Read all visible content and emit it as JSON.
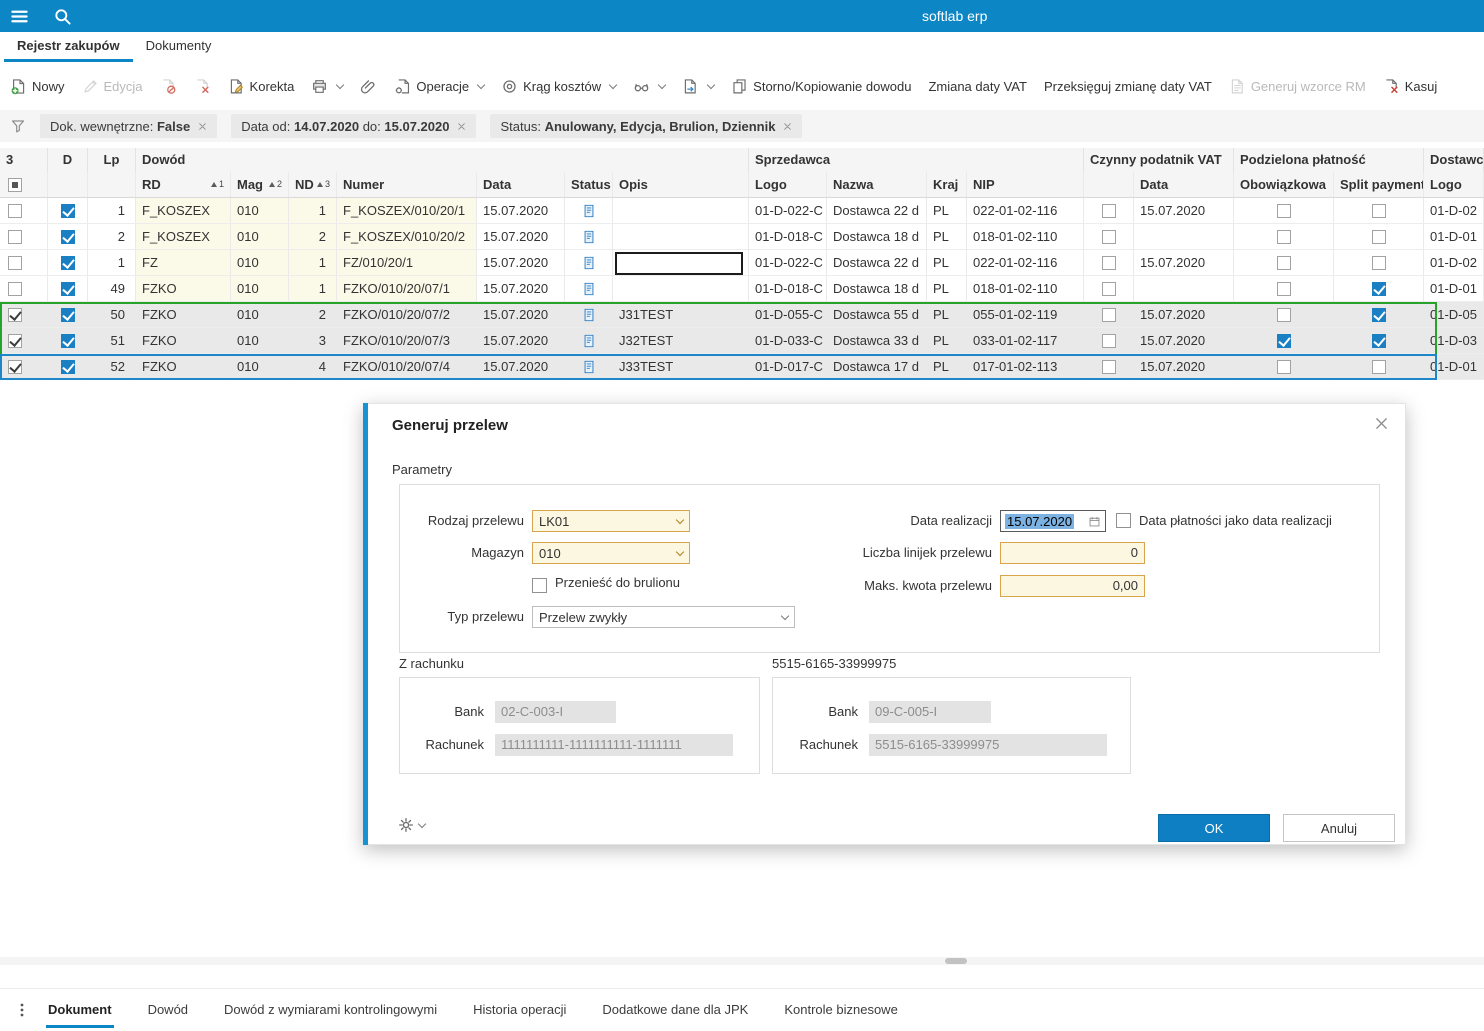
{
  "topbar": {
    "title": "softlab erp"
  },
  "nav": {
    "tab1": "Rejestr zakupów",
    "tab2": "Dokumenty"
  },
  "toolbar": {
    "nowy": "Nowy",
    "edycja": "Edycja",
    "korekta": "Korekta",
    "operacje": "Operacje",
    "krag_kosztow": "Krąg kosztów",
    "storno": "Storno/Kopiowanie dowodu",
    "zmiana_daty_vat": "Zmiana daty VAT",
    "przeksieguj": "Przeksięguj zmianę daty VAT",
    "generuj_wzorce": "Generuj wzorce RM",
    "kasuj": "Kasuj"
  },
  "filterbar": {
    "chip1_label": "Dok. wewnętrzne:",
    "chip1_value": "False",
    "chip2_label": "Data od:",
    "chip2_date1": "14.07.2020",
    "chip2_mid": "do:",
    "chip2_date2": "15.07.2020",
    "chip3_label": "Status:",
    "chip3_value": "Anulowany, Edycja, Brulion, Dziennik"
  },
  "grid": {
    "selected_count": "3",
    "groups": {
      "d": "D",
      "lp": "Lp",
      "dowod": "Dowód",
      "sprzedawca": "Sprzedawca",
      "czynny": "Czynny podatnik VAT",
      "podzielona": "Podzielona płatność",
      "dostawca": "Dostawca"
    },
    "cols": {
      "rd": "RD",
      "mag": "Mag",
      "nd": "ND",
      "numer": "Numer",
      "data": "Data",
      "status": "Status",
      "opis": "Opis",
      "logo": "Logo",
      "nazwa": "Nazwa",
      "kraj": "Kraj",
      "nip": "NIP",
      "data_vat": "Data",
      "obowiazkowa": "Obowiązkowa",
      "split": "Split payment",
      "logo2": "Logo"
    },
    "sort": {
      "rd": "1",
      "mag": "2",
      "nd": "3"
    },
    "rows": [
      {
        "sel": false,
        "d": true,
        "lp": "1",
        "rd": "F_KOSZEX",
        "mag": "010",
        "nd": "1",
        "numer": "F_KOSZEX/010/20/1",
        "data": "15.07.2020",
        "opis": "",
        "logo": "01-D-022-C",
        "nazwa": "Dostawca 22 d",
        "kraj": "PL",
        "nip": "022-01-02-116",
        "vat_chk": false,
        "vat_data": "15.07.2020",
        "obow": false,
        "split": false,
        "logo2": "01-D-02"
      },
      {
        "sel": false,
        "d": true,
        "lp": "2",
        "rd": "F_KOSZEX",
        "mag": "010",
        "nd": "2",
        "numer": "F_KOSZEX/010/20/2",
        "data": "15.07.2020",
        "opis": "",
        "logo": "01-D-018-C",
        "nazwa": "Dostawca 18 d",
        "kraj": "PL",
        "nip": "018-01-02-110",
        "vat_chk": false,
        "vat_data": "",
        "obow": false,
        "split": false,
        "logo2": "01-D-01"
      },
      {
        "sel": false,
        "d": true,
        "lp": "1",
        "rd": "FZ",
        "mag": "010",
        "nd": "1",
        "numer": "FZ/010/20/1",
        "data": "15.07.2020",
        "opis": "",
        "logo": "01-D-022-C",
        "nazwa": "Dostawca 22 d",
        "kraj": "PL",
        "nip": "022-01-02-116",
        "vat_chk": false,
        "vat_data": "15.07.2020",
        "obow": false,
        "split": false,
        "logo2": "01-D-02"
      },
      {
        "sel": false,
        "d": true,
        "lp": "49",
        "rd": "FZKO",
        "mag": "010",
        "nd": "1",
        "numer": "FZKO/010/20/07/1",
        "data": "15.07.2020",
        "opis": "",
        "logo": "01-D-018-C",
        "nazwa": "Dostawca 18 d",
        "kraj": "PL",
        "nip": "018-01-02-110",
        "vat_chk": false,
        "vat_data": "",
        "obow": false,
        "split": true,
        "logo2": "01-D-01"
      },
      {
        "sel": true,
        "d": true,
        "lp": "50",
        "rd": "FZKO",
        "mag": "010",
        "nd": "2",
        "numer": "FZKO/010/20/07/2",
        "data": "15.07.2020",
        "opis": "J31TEST",
        "logo": "01-D-055-C",
        "nazwa": "Dostawca 55 d",
        "kraj": "PL",
        "nip": "055-01-02-119",
        "vat_chk": false,
        "vat_data": "15.07.2020",
        "obow": false,
        "split": true,
        "logo2": "01-D-05"
      },
      {
        "sel": true,
        "d": true,
        "lp": "51",
        "rd": "FZKO",
        "mag": "010",
        "nd": "3",
        "numer": "FZKO/010/20/07/3",
        "data": "15.07.2020",
        "opis": "J32TEST",
        "logo": "01-D-033-C",
        "nazwa": "Dostawca 33 d",
        "kraj": "PL",
        "nip": "033-01-02-117",
        "vat_chk": false,
        "vat_data": "15.07.2020",
        "obow": true,
        "split": true,
        "logo2": "01-D-03"
      },
      {
        "sel": true,
        "d": true,
        "lp": "52",
        "rd": "FZKO",
        "mag": "010",
        "nd": "4",
        "numer": "FZKO/010/20/07/4",
        "data": "15.07.2020",
        "opis": "J33TEST",
        "logo": "01-D-017-C",
        "nazwa": "Dostawca 17 d",
        "kraj": "PL",
        "nip": "017-01-02-113",
        "vat_chk": false,
        "vat_data": "15.07.2020",
        "obow": false,
        "split": false,
        "logo2": "01-D-01"
      }
    ]
  },
  "dialog": {
    "title": "Generuj przelew",
    "parametry": "Parametry",
    "rodzaj_label": "Rodzaj przelewu",
    "rodzaj_value": "LK01",
    "magazyn_label": "Magazyn",
    "magazyn_value": "010",
    "brulion_label": "Przenieść do brulionu",
    "typ_label": "Typ przelewu",
    "typ_value": "Przelew zwykły",
    "data_real_label": "Data realizacji",
    "data_real_value": "15.07.2020",
    "data_plat_label": "Data płatności jako data realizacji",
    "liczba_label": "Liczba linijek przelewu",
    "liczba_value": "0",
    "maks_label": "Maks. kwota przelewu",
    "maks_value": "0,00",
    "z_rachunku": "Z rachunku",
    "na_rachunek": "5515-6165-33999975",
    "bank_label": "Bank",
    "rachunek_label": "Rachunek",
    "z_bank": "02-C-003-I",
    "z_rachunek": "1111111111-1111111111-1111111",
    "na_bank": "09-C-005-I",
    "ok": "OK",
    "anuluj": "Anuluj"
  },
  "footer_tabs": {
    "t1": "Dokument",
    "t2": "Dowód",
    "t3": "Dowód z wymiarami kontrolingowymi",
    "t4": "Historia operacji",
    "t5": "Dodatkowe dane dla JPK",
    "t6": "Kontrole biznesowe"
  }
}
